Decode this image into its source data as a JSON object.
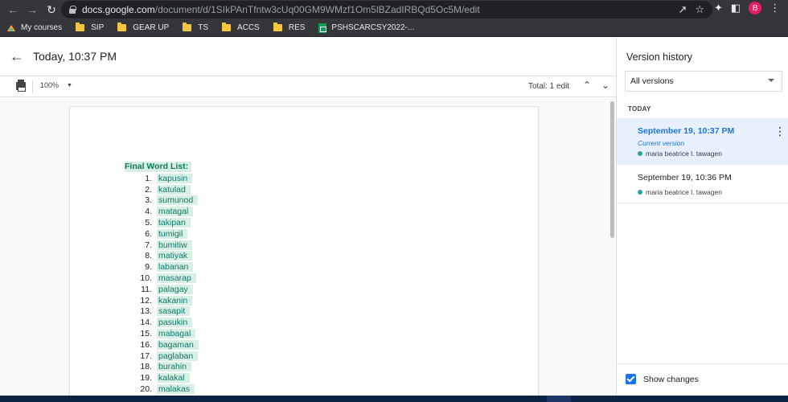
{
  "browser": {
    "url_host": "docs.google.com",
    "url_path": "/document/d/1SIkPAnTfntw3cUq00GM9WMzf1Om5lBZadIRBQd5Oc5M/edit",
    "profile_initial": "B",
    "bookmarks": [
      {
        "label": "My courses",
        "icon": "moodle-icon"
      },
      {
        "label": "SIP",
        "icon": "folder-icon"
      },
      {
        "label": "GEAR UP",
        "icon": "folder-icon"
      },
      {
        "label": "TS",
        "icon": "folder-icon"
      },
      {
        "label": "ACCS",
        "icon": "folder-icon"
      },
      {
        "label": "RES",
        "icon": "folder-icon"
      },
      {
        "label": "PSHSCARCSY2022-...",
        "icon": "sheets-icon"
      }
    ]
  },
  "header": {
    "title": "Today, 10:37 PM"
  },
  "toolbar": {
    "zoom": "100%",
    "total_edits": "Total: 1 edit"
  },
  "document": {
    "heading": "Final Word List:",
    "words": [
      {
        "num": "1.",
        "word": "kapusin"
      },
      {
        "num": "2.",
        "word": "katulad"
      },
      {
        "num": "3.",
        "word": "sumunod"
      },
      {
        "num": "4.",
        "word": "matagal"
      },
      {
        "num": "5.",
        "word": "takipan"
      },
      {
        "num": "6.",
        "word": "tumigil"
      },
      {
        "num": "7.",
        "word": "bumitiw"
      },
      {
        "num": "8.",
        "word": "matiyak"
      },
      {
        "num": "9.",
        "word": "labanan"
      },
      {
        "num": "10.",
        "word": "masarap"
      },
      {
        "num": "11.",
        "word": "palagay"
      },
      {
        "num": "12.",
        "word": "kakanin"
      },
      {
        "num": "13.",
        "word": "sasapit"
      },
      {
        "num": "14.",
        "word": "pasukin"
      },
      {
        "num": "15.",
        "word": "mabagal"
      },
      {
        "num": "16.",
        "word": "bagaman"
      },
      {
        "num": "17.",
        "word": "paglaban"
      },
      {
        "num": "18.",
        "word": "burahin"
      },
      {
        "num": "19.",
        "word": "kalakal"
      },
      {
        "num": "20.",
        "word": "malakas"
      }
    ]
  },
  "version_history": {
    "title": "Version history",
    "filter": "All versions",
    "section": "TODAY",
    "versions": [
      {
        "date": "September 19, 10:37 PM",
        "label": "Current version",
        "author": "maria beatrice l. tawagen"
      },
      {
        "date": "September 19, 10:36 PM",
        "author": "maria beatrice l. tawagen"
      }
    ],
    "show_changes_label": "Show changes",
    "show_changes_checked": true
  },
  "colors": {
    "highlight": "#d7efe5",
    "word_text": "#0d7a6b",
    "accent": "#1a73e8",
    "author_dot": "#26a69a"
  }
}
